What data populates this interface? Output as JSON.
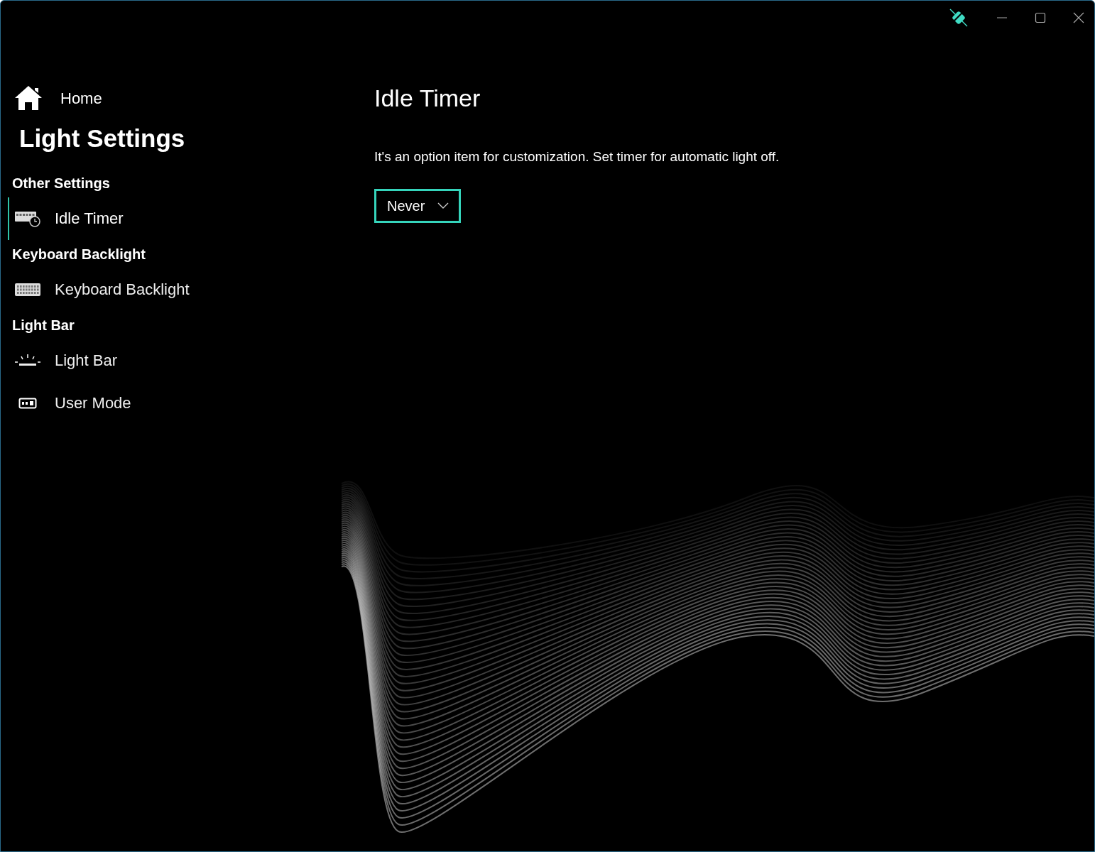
{
  "home": {
    "label": "Home"
  },
  "title": "Light Settings",
  "groups": [
    {
      "heading": "Other Settings",
      "items": [
        {
          "label": "Idle Timer",
          "selected": true
        }
      ]
    },
    {
      "heading": "Keyboard Backlight",
      "items": [
        {
          "label": "Keyboard Backlight",
          "selected": false
        }
      ]
    },
    {
      "heading": "Light Bar",
      "items": [
        {
          "label": "Light Bar",
          "selected": false
        },
        {
          "label": "User Mode",
          "selected": false
        }
      ]
    }
  ],
  "content": {
    "heading": "Idle Timer",
    "description": "It's an option item for customization. Set timer for automatic light off.",
    "dropdown": {
      "value": "Never"
    }
  }
}
